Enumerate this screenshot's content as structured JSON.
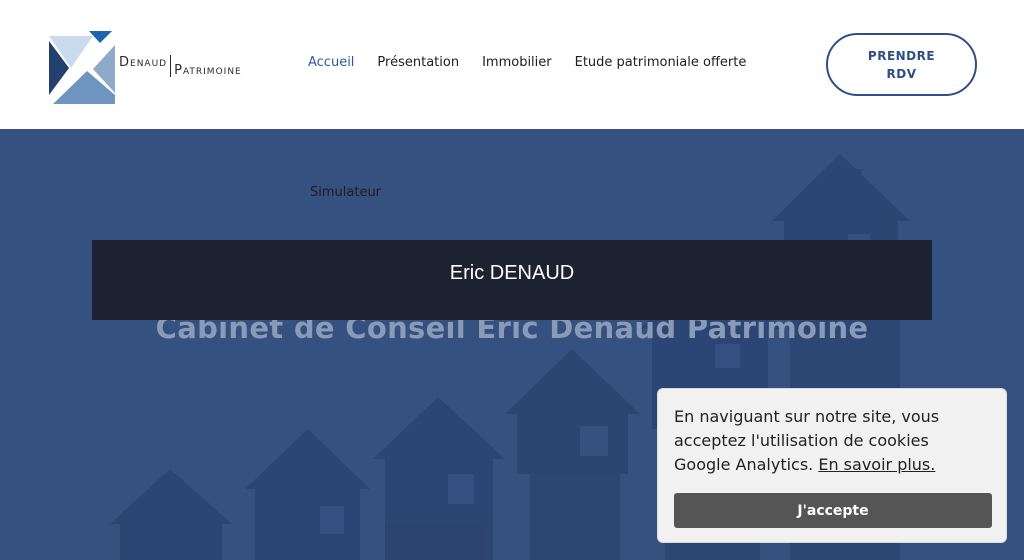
{
  "header": {
    "logo": {
      "first": "Denaud",
      "second": "Patrimoine"
    },
    "nav": [
      {
        "label": "Accueil",
        "active": true
      },
      {
        "label": "Présentation",
        "active": false
      },
      {
        "label": "Immobilier",
        "active": false
      },
      {
        "label": "Etude patrimoniale offerte",
        "active": false
      }
    ],
    "cta": {
      "line1": "PRENDRE",
      "line2": "RDV"
    }
  },
  "hero": {
    "subnav": "Simulateur",
    "banner_name": "Eric DENAUD",
    "title": "Cabinet de Conseil Eric Denaud Patrimoine"
  },
  "cookie": {
    "text": "En naviguant sur notre site, vous acceptez l'utilisation de cookies Google Analytics.",
    "link": "En savoir plus.",
    "button": "J'accepte"
  },
  "colors": {
    "brand_blue": "#2e4f86",
    "hero_bg": "#34517f",
    "banner_bg": "#1c2232",
    "cookie_button": "#555555"
  }
}
